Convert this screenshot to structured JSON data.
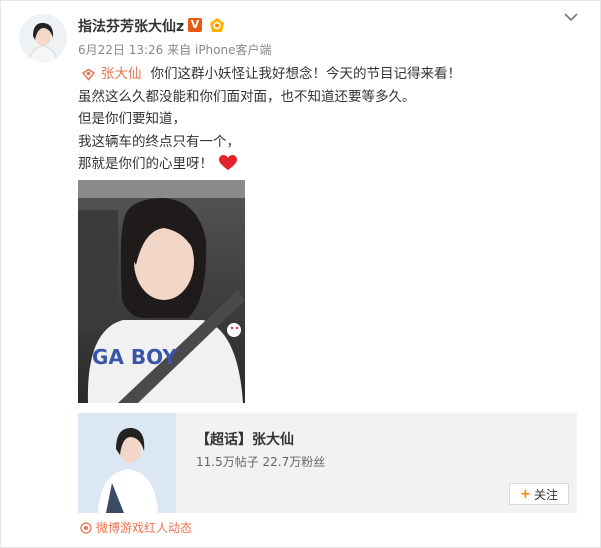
{
  "post": {
    "username": "指法芬芳张大仙z",
    "v_badge": "V",
    "date": "6月22日 13:26",
    "from_prefix": "来自",
    "device": "iPhone客户端",
    "topic": "张大仙",
    "lines": [
      "你们这群小妖怪让我好想念！今天的节目记得来看！",
      "虽然这么久都没能和你们面对面，也不知道还要等多久。",
      "但是你们要知道，",
      "我这辆车的终点只有一个，",
      "那就是你们的心里呀！"
    ],
    "shirt_text": "GA BOY"
  },
  "chaohua": {
    "title": "【超话】张大仙",
    "stats": "11.5万帖子 22.7万粉丝",
    "follow_label": "关注",
    "follow_plus": "+"
  },
  "source_label": "微博游戏红人动态",
  "colors": {
    "accent": "#eb7350",
    "v_badge": "#e75a10",
    "heart": "#e0252a",
    "follow_plus": "#ff8200"
  },
  "icons": [
    "chevron-down-icon",
    "verified-v-icon",
    "level-badge-icon",
    "topic-icon",
    "heart-icon",
    "plus-icon",
    "source-icon"
  ]
}
